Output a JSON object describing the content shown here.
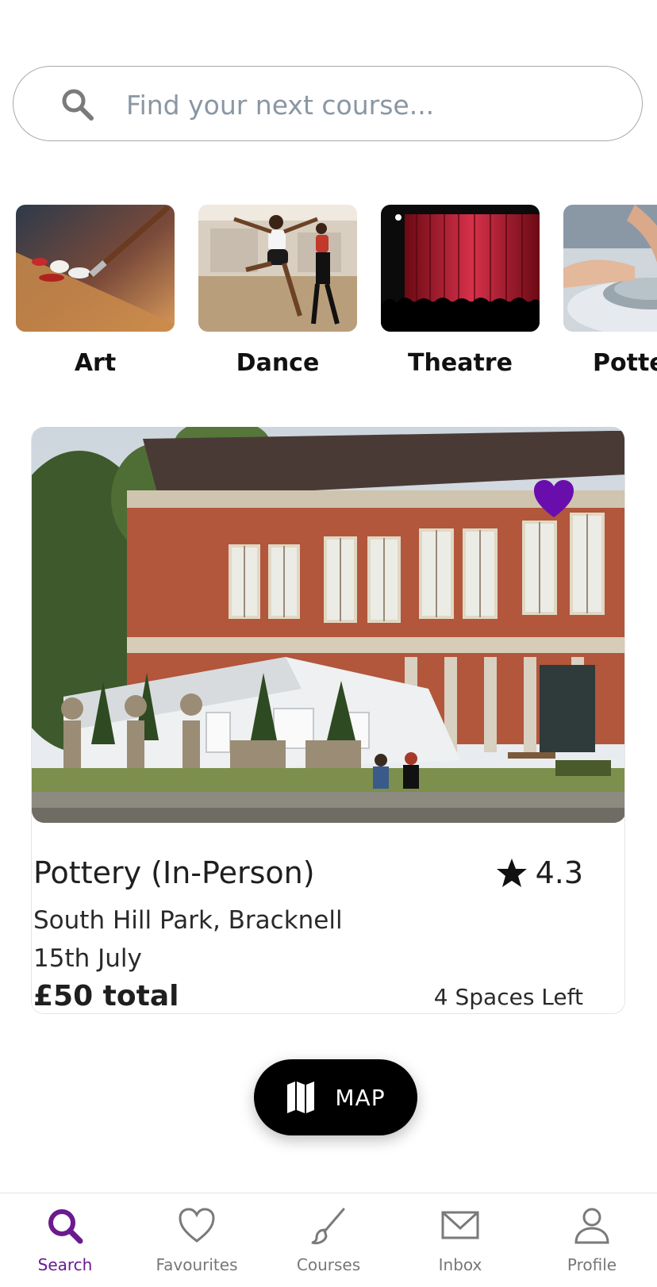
{
  "search": {
    "placeholder": "Find your next course..."
  },
  "categories": [
    {
      "label": "Art",
      "icon": "art-image"
    },
    {
      "label": "Dance",
      "icon": "dance-image"
    },
    {
      "label": "Theatre",
      "icon": "theatre-image"
    },
    {
      "label": "Pottery",
      "icon": "pottery-image"
    }
  ],
  "course": {
    "title": "Pottery (In-Person)",
    "rating": "4.3",
    "location": "South Hill Park, Bracknell",
    "date": "15th July",
    "price": "£50 total",
    "spaces": "4 Spaces Left",
    "favourited": true,
    "favourite_color": "#6a0dad"
  },
  "map_button": {
    "label": "MAP"
  },
  "nav": {
    "items": [
      {
        "label": "Search",
        "icon": "search-icon",
        "active": true
      },
      {
        "label": "Favourites",
        "icon": "heart-icon",
        "active": false
      },
      {
        "label": "Courses",
        "icon": "brush-icon",
        "active": false
      },
      {
        "label": "Inbox",
        "icon": "mail-icon",
        "active": false
      },
      {
        "label": "Profile",
        "icon": "person-icon",
        "active": false
      }
    ],
    "active_color": "#6b1a8f",
    "inactive_color": "#7a7a7a"
  }
}
